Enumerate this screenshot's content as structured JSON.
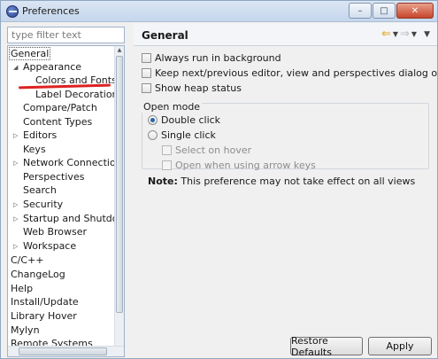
{
  "window": {
    "title": "Preferences"
  },
  "filter": {
    "placeholder": "type filter text"
  },
  "tree": {
    "items": [
      {
        "label": "General"
      },
      {
        "label": "Appearance"
      },
      {
        "label": "Colors and Fonts"
      },
      {
        "label": "Label Decorations"
      },
      {
        "label": "Compare/Patch"
      },
      {
        "label": "Content Types"
      },
      {
        "label": "Editors"
      },
      {
        "label": "Keys"
      },
      {
        "label": "Network Connections"
      },
      {
        "label": "Perspectives"
      },
      {
        "label": "Search"
      },
      {
        "label": "Security"
      },
      {
        "label": "Startup and Shutdown"
      },
      {
        "label": "Web Browser"
      },
      {
        "label": "Workspace"
      },
      {
        "label": "C/C++"
      },
      {
        "label": "ChangeLog"
      },
      {
        "label": "Help"
      },
      {
        "label": "Install/Update"
      },
      {
        "label": "Library Hover"
      },
      {
        "label": "Mylyn"
      },
      {
        "label": "Remote Systems"
      }
    ]
  },
  "page": {
    "heading": "General",
    "options": {
      "always_run_background": "Always run in background",
      "keep_next_previous": "Keep next/previous editor, view and perspectives dialog open",
      "show_heap_status": "Show heap status"
    },
    "open_mode": {
      "title": "Open mode",
      "double_click": "Double click",
      "single_click": "Single click",
      "select_on_hover": "Select on hover",
      "open_arrow_keys": "Open when using arrow keys",
      "selected": "Double click"
    },
    "note_label": "Note:",
    "note_text": "This preference may not take effect on all views"
  },
  "buttons": {
    "restore_defaults": "Restore Defaults",
    "apply": "Apply"
  },
  "colors": {
    "selection_underline": "#d22222",
    "back_arrow": "#e1a21a"
  }
}
